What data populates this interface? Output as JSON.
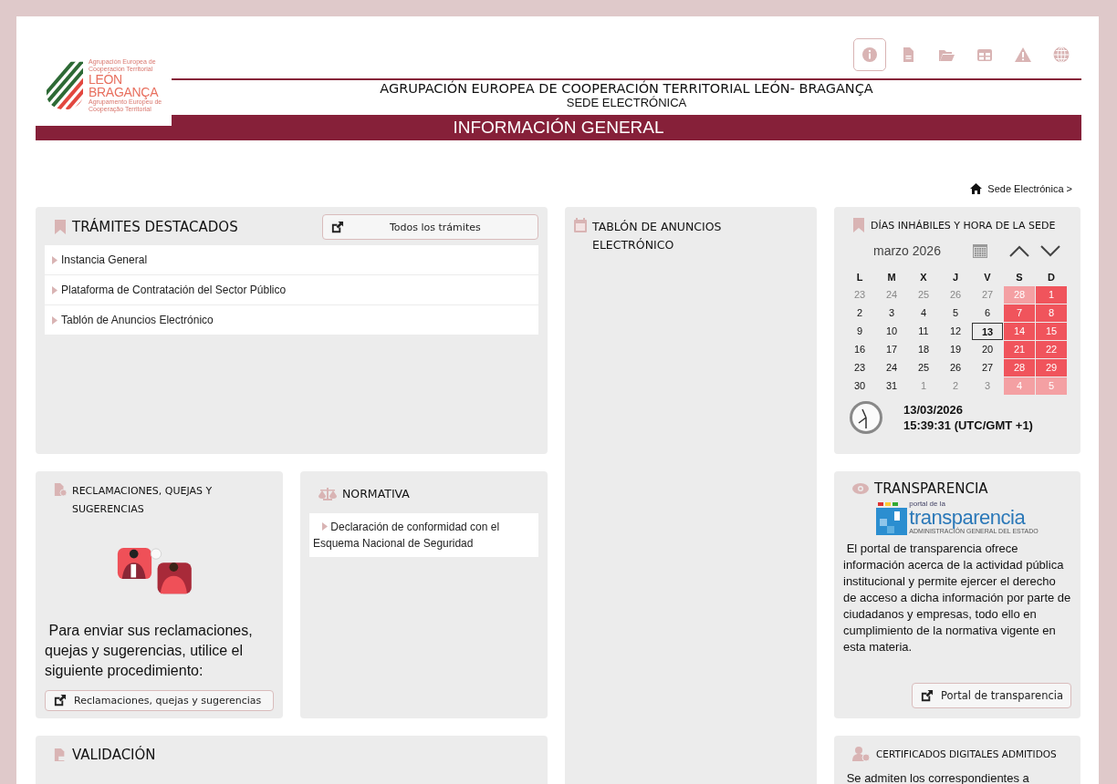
{
  "logo": {
    "top_line": "Agrupación Europea de Cooperación Territorial",
    "name_1": "LEÓN",
    "name_2": "BRAGANÇA",
    "bottom_line": "Agrupamento Europeu de Cooperação Territorial"
  },
  "nav_icons": [
    {
      "kind": "info",
      "selected": true
    },
    {
      "kind": "file",
      "selected": false
    },
    {
      "kind": "folder",
      "selected": false
    },
    {
      "kind": "grid",
      "selected": false
    },
    {
      "kind": "warning",
      "selected": false
    },
    {
      "kind": "globe",
      "selected": false
    }
  ],
  "header": {
    "title": "AGRUPACIÓN EUROPEA DE COOPERACIÓN TERRITORIAL LEÓN- BRAGANÇA",
    "subtitle": "SEDE ELECTRÓNICA",
    "banner": "INFORMACIÓN GENERAL"
  },
  "breadcrumb": "Sede Electrónica >",
  "tramites": {
    "title": "TRÁMITES DESTACADOS",
    "button": "Todos los trámites",
    "items": [
      "Instancia General",
      "Plataforma de Contratación del Sector Público",
      "Tablón de Anuncios Electrónico"
    ]
  },
  "tablon": {
    "title": "TABLÓN DE ANUNCIOS ELECTRÓNICO"
  },
  "calendar": {
    "title": "DÍAS INHÁBILES Y HORA DE LA SEDE",
    "month": "marzo 2026",
    "weekdays": [
      "L",
      "M",
      "X",
      "J",
      "V",
      "S",
      "D"
    ],
    "weeks": [
      [
        {
          "d": "23",
          "out": true,
          "holiday": false,
          "today": false
        },
        {
          "d": "24",
          "out": true,
          "holiday": false,
          "today": false
        },
        {
          "d": "25",
          "out": true,
          "holiday": false,
          "today": false
        },
        {
          "d": "26",
          "out": true,
          "holiday": false,
          "today": false
        },
        {
          "d": "27",
          "out": true,
          "holiday": false,
          "today": false
        },
        {
          "d": "28",
          "out": true,
          "holiday": true,
          "today": false
        },
        {
          "d": "1",
          "out": false,
          "holiday": true,
          "today": false
        }
      ],
      [
        {
          "d": "2",
          "out": false,
          "holiday": false,
          "today": false
        },
        {
          "d": "3",
          "out": false,
          "holiday": false,
          "today": false
        },
        {
          "d": "4",
          "out": false,
          "holiday": false,
          "today": false
        },
        {
          "d": "5",
          "out": false,
          "holiday": false,
          "today": false
        },
        {
          "d": "6",
          "out": false,
          "holiday": false,
          "today": false
        },
        {
          "d": "7",
          "out": false,
          "holiday": true,
          "today": false
        },
        {
          "d": "8",
          "out": false,
          "holiday": true,
          "today": false
        }
      ],
      [
        {
          "d": "9",
          "out": false,
          "holiday": false,
          "today": false
        },
        {
          "d": "10",
          "out": false,
          "holiday": false,
          "today": false
        },
        {
          "d": "11",
          "out": false,
          "holiday": false,
          "today": false
        },
        {
          "d": "12",
          "out": false,
          "holiday": false,
          "today": false
        },
        {
          "d": "13",
          "out": false,
          "holiday": false,
          "today": true
        },
        {
          "d": "14",
          "out": false,
          "holiday": true,
          "today": false
        },
        {
          "d": "15",
          "out": false,
          "holiday": true,
          "today": false
        }
      ],
      [
        {
          "d": "16",
          "out": false,
          "holiday": false,
          "today": false
        },
        {
          "d": "17",
          "out": false,
          "holiday": false,
          "today": false
        },
        {
          "d": "18",
          "out": false,
          "holiday": false,
          "today": false
        },
        {
          "d": "19",
          "out": false,
          "holiday": false,
          "today": false
        },
        {
          "d": "20",
          "out": false,
          "holiday": false,
          "today": false
        },
        {
          "d": "21",
          "out": false,
          "holiday": true,
          "today": false
        },
        {
          "d": "22",
          "out": false,
          "holiday": true,
          "today": false
        }
      ],
      [
        {
          "d": "23",
          "out": false,
          "holiday": false,
          "today": false
        },
        {
          "d": "24",
          "out": false,
          "holiday": false,
          "today": false
        },
        {
          "d": "25",
          "out": false,
          "holiday": false,
          "today": false
        },
        {
          "d": "26",
          "out": false,
          "holiday": false,
          "today": false
        },
        {
          "d": "27",
          "out": false,
          "holiday": false,
          "today": false
        },
        {
          "d": "28",
          "out": false,
          "holiday": true,
          "today": false
        },
        {
          "d": "29",
          "out": false,
          "holiday": true,
          "today": false
        }
      ],
      [
        {
          "d": "30",
          "out": false,
          "holiday": false,
          "today": false
        },
        {
          "d": "31",
          "out": false,
          "holiday": false,
          "today": false
        },
        {
          "d": "1",
          "out": true,
          "holiday": false,
          "today": false
        },
        {
          "d": "2",
          "out": true,
          "holiday": false,
          "today": false
        },
        {
          "d": "3",
          "out": true,
          "holiday": false,
          "today": false
        },
        {
          "d": "4",
          "out": true,
          "holiday": true,
          "today": false
        },
        {
          "d": "5",
          "out": true,
          "holiday": true,
          "today": false
        }
      ]
    ],
    "date": "13/03/2026",
    "time": "15:39:31 (UTC/GMT +1)"
  },
  "reclamaciones": {
    "title": "RECLAMACIONES, QUEJAS Y SUGERENCIAS",
    "text": "Para enviar sus reclamaciones, quejas y sugerencias, utilice el siguiente procedimiento:",
    "button": "Reclamaciones, quejas y sugerencias"
  },
  "normativa": {
    "title": "NORMATIVA",
    "items": [
      "Declaración de conformidad con el Esquema Nacional de Seguridad"
    ]
  },
  "transparencia": {
    "title": "TRANSPARENCIA",
    "logo_top": "portal de la",
    "logo_main": "transparencia",
    "logo_sub": "ADMINISTRACIÓN GENERAL DEL ESTADO",
    "text": "El portal de transparencia ofrece información acerca de la actividad pública institucional y permite ejercer el derecho de acceso a dicha información por parte de ciudadanos y empresas, todo ello en cumplimiento de la normativa vigente en esta materia.",
    "button": "Portal de transparencia"
  },
  "validacion": {
    "title": "VALIDACIÓN"
  },
  "certificados": {
    "title": "CERTIFICADOS DIGITALES ADMITIDOS",
    "text": "Se admiten los correspondientes a"
  }
}
